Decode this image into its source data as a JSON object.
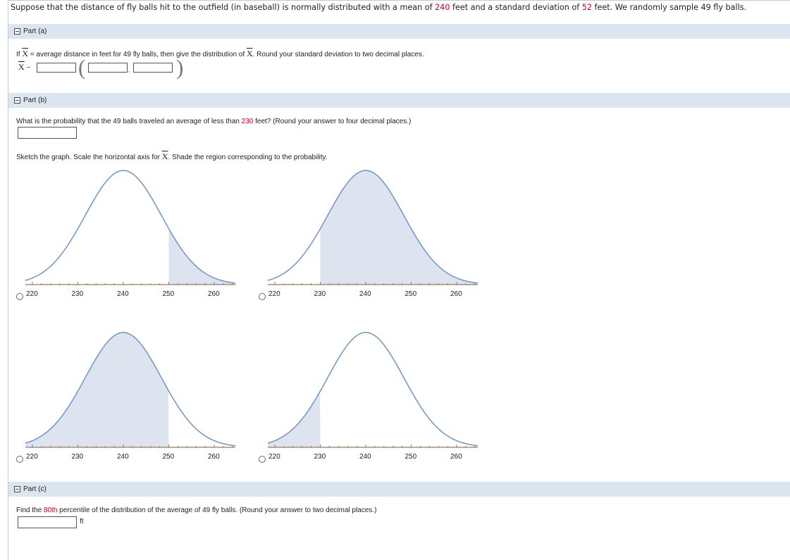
{
  "problem": {
    "intro_a": "Suppose that the distance of fly balls hit to the outfield (in baseball) is normally distributed with a mean of ",
    "mean": "240",
    "intro_b": " feet and a standard deviation of ",
    "sd": "52",
    "intro_c": " feet. We randomly sample 49 fly balls."
  },
  "part_a": {
    "title": "Part (a)",
    "q_pre": "If ",
    "xbar": "X",
    "q_post": " = average distance in feet for 49 fly balls, then give the distribution of ",
    "q_end": ". Round your standard deviation to two decimal places.",
    "dist_tilde": "~",
    "distribution_value": "",
    "param1_value": "",
    "param2_value": "",
    "comma": ","
  },
  "part_b": {
    "title": "Part (b)",
    "q_pre": "What is the probability that the 49 balls traveled an average of less than ",
    "value": "230",
    "q_post": " feet? (Round your answer to four decimal places.)",
    "answer_value": "",
    "sketch_pre": "Sketch the graph. Scale the horizontal axis for ",
    "sketch_post": ". Shade the region corresponding to the probability.",
    "options": [
      {
        "ticks": [
          "220",
          "230",
          "240",
          "250",
          "260"
        ],
        "shade": "right of 250"
      },
      {
        "ticks": [
          "220",
          "230",
          "240",
          "250",
          "260"
        ],
        "shade": "right of 230"
      },
      {
        "ticks": [
          "220",
          "230",
          "240",
          "250",
          "260"
        ],
        "shade": "left of 250"
      },
      {
        "ticks": [
          "220",
          "230",
          "240",
          "250",
          "260"
        ],
        "shade": "left of 230"
      }
    ]
  },
  "part_c": {
    "title": "Part (c)",
    "q_pre": "Find the ",
    "percentile": "80th",
    "q_post": " percentile of the distribution of the average of 49 fly balls. (Round your answer to two decimal places.)",
    "answer_value": "",
    "unit": "ft"
  },
  "colors": {
    "header_bg": "#dce6f0",
    "highlight": "#d1001f",
    "curve": "#6f94c6",
    "shade": "#dde4ef"
  }
}
